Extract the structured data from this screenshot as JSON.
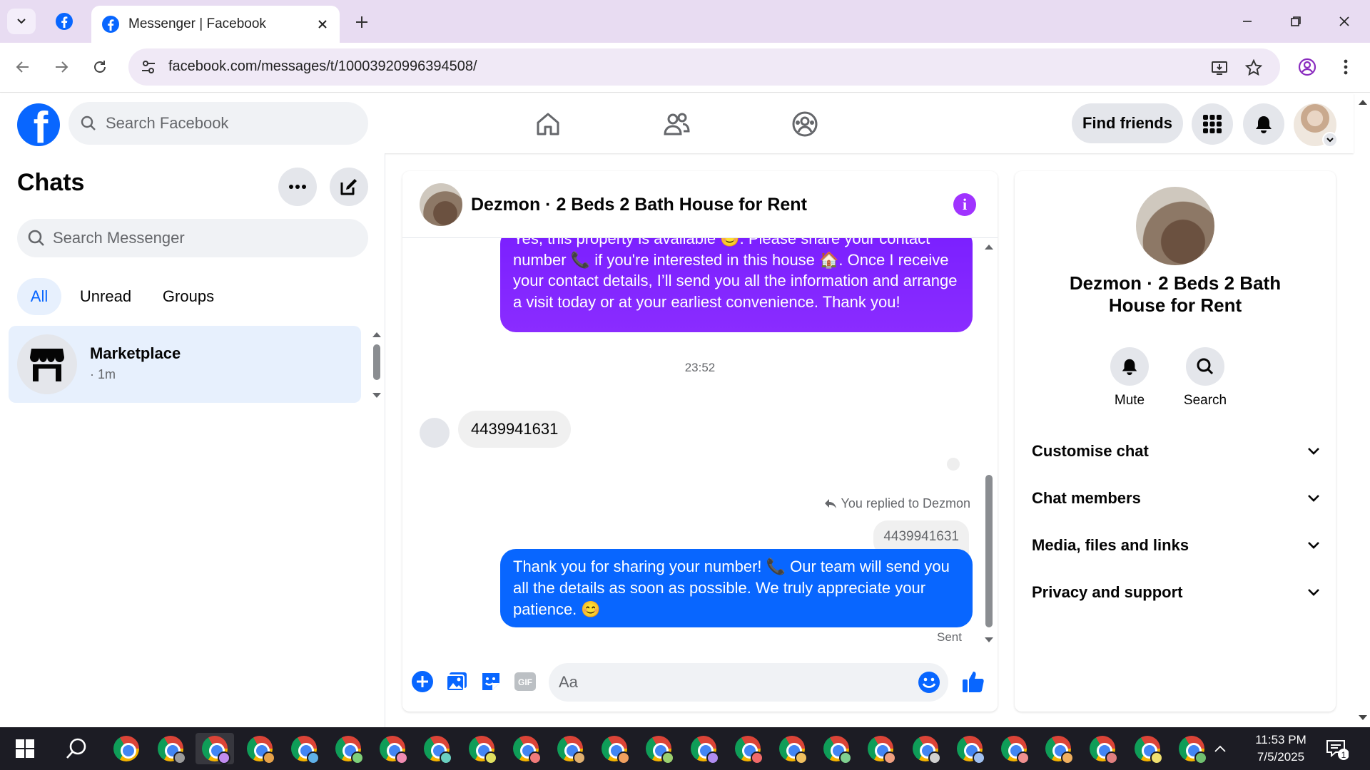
{
  "browser": {
    "tab_title": "Messenger | Facebook",
    "url": "facebook.com/messages/t/10003920996394508/"
  },
  "fb": {
    "search_placeholder": "Search Facebook",
    "find_friends": "Find friends"
  },
  "sidebar": {
    "title": "Chats",
    "search_placeholder": "Search Messenger",
    "filters": [
      "All",
      "Unread",
      "Groups"
    ],
    "chat": {
      "name": "Marketplace",
      "meta": "· 1m"
    }
  },
  "conversation": {
    "title": "Dezmon · 2 Beds 2 Bath House for Rent",
    "msg1": "Yes, this property is available 😊. Please share your contact number 📞 if you're interested in this house 🏠. Once I receive your contact details, I’ll send you all the information and arrange a visit today or at your earliest convenience. Thank you!",
    "timestamp": "23:52",
    "incoming": "4439941631",
    "replied_label": "You replied to Dezmon",
    "quoted": "4439941631",
    "msg2": "Thank you for sharing your number! 📞 Our team will send you all the details as soon as possible. We truly appreciate your patience. 😊",
    "status": "Sent",
    "composer_placeholder": "Aa"
  },
  "info_panel": {
    "name": "Dezmon · 2 Beds 2 Bath House for Rent",
    "actions": [
      "Mute",
      "Search"
    ],
    "sections": [
      "Customise chat",
      "Chat members",
      "Media, files and links",
      "Privacy and support"
    ]
  },
  "taskbar": {
    "time": "11:53 PM",
    "date": "7/5/2025",
    "notifications": "1"
  },
  "colors": {
    "fb_blue": "#0866ff",
    "messenger_purple": "#8a2cff",
    "selected_bg": "#e7f0fd"
  }
}
